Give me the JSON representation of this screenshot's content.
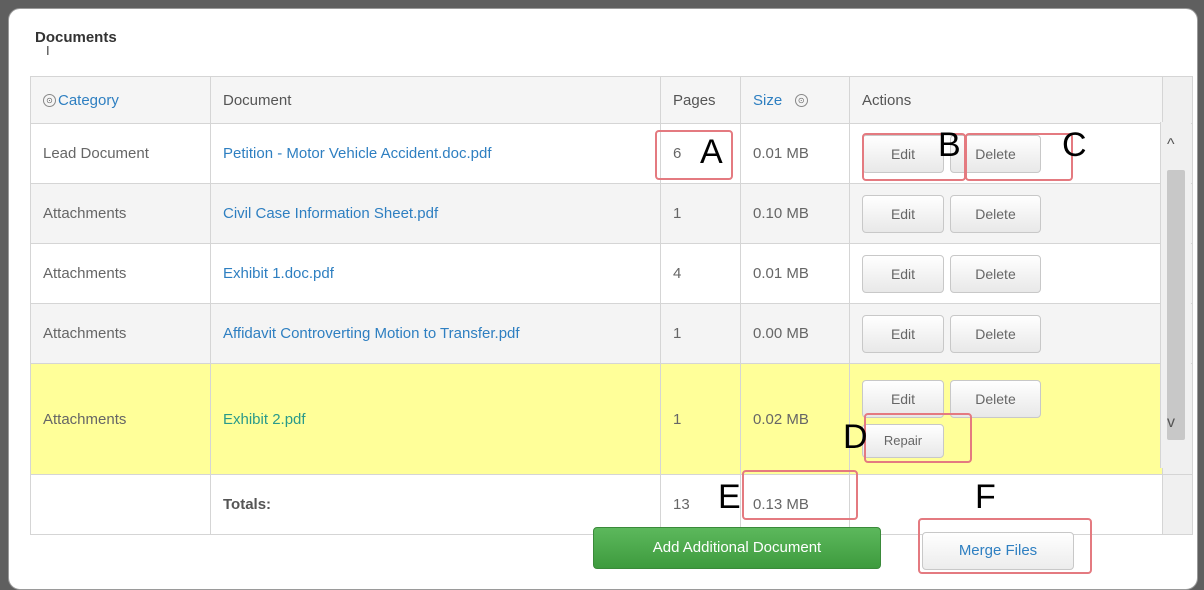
{
  "panel": {
    "title": "Documents",
    "cursor_glyph": "I"
  },
  "columns": {
    "category": "Category",
    "document": "Document",
    "pages": "Pages",
    "size": "Size",
    "actions": "Actions"
  },
  "rows": [
    {
      "category": "Lead Document",
      "document": "Petition - Motor Vehicle Accident.doc.pdf",
      "pages": "6",
      "size": "0.01 MB"
    },
    {
      "category": "Attachments",
      "document": "Civil Case Information Sheet.pdf",
      "pages": "1",
      "size": "0.10 MB"
    },
    {
      "category": "Attachments",
      "document": "Exhibit 1.doc.pdf",
      "pages": "4",
      "size": "0.01 MB"
    },
    {
      "category": "Attachments",
      "document": "Affidavit Controverting Motion to Transfer.pdf",
      "pages": "1",
      "size": "0.00 MB"
    },
    {
      "category": "Attachments",
      "document": "Exhibit 2.pdf",
      "pages": "1",
      "size": "0.02 MB"
    }
  ],
  "actions": {
    "edit": "Edit",
    "delete": "Delete",
    "repair": "Repair"
  },
  "totals": {
    "label": "Totals:",
    "pages": "13",
    "size": "0.13 MB"
  },
  "buttons": {
    "add": "Add Additional Document",
    "merge": "Merge Files"
  },
  "annotations": {
    "a": "A",
    "b": "B",
    "c": "C",
    "d": "D",
    "e": "E",
    "f": "F"
  },
  "icons": {
    "sort": "⊙",
    "scroll_up": "^",
    "scroll_down": "v"
  },
  "colors": {
    "highlight_row": "#ffff99",
    "link": "#2e7fc1",
    "annotation_box": "#e47a80",
    "add_button": "#4cae4c"
  }
}
